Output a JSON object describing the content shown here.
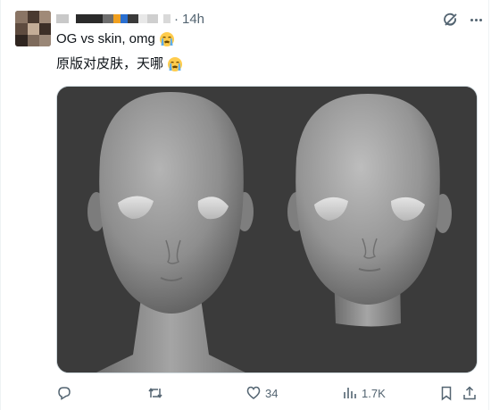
{
  "tweet": {
    "time": "14h",
    "separator": "·",
    "text_line1": "OG vs skin, omg",
    "text_line2": "原版对皮肤，天哪",
    "emoji": "loudly-crying-face"
  },
  "actions": {
    "replies": "",
    "reposts": "",
    "likes": "34",
    "views": "1.7K"
  },
  "icons": [
    "grok-icon",
    "more-icon",
    "reply-icon",
    "repost-icon",
    "like-icon",
    "views-icon",
    "bookmark-icon",
    "share-icon"
  ],
  "colors": {
    "text": "#0f1419",
    "secondary": "#536471",
    "media_bg": "#3a3a3a",
    "border": "#eff3f4"
  }
}
